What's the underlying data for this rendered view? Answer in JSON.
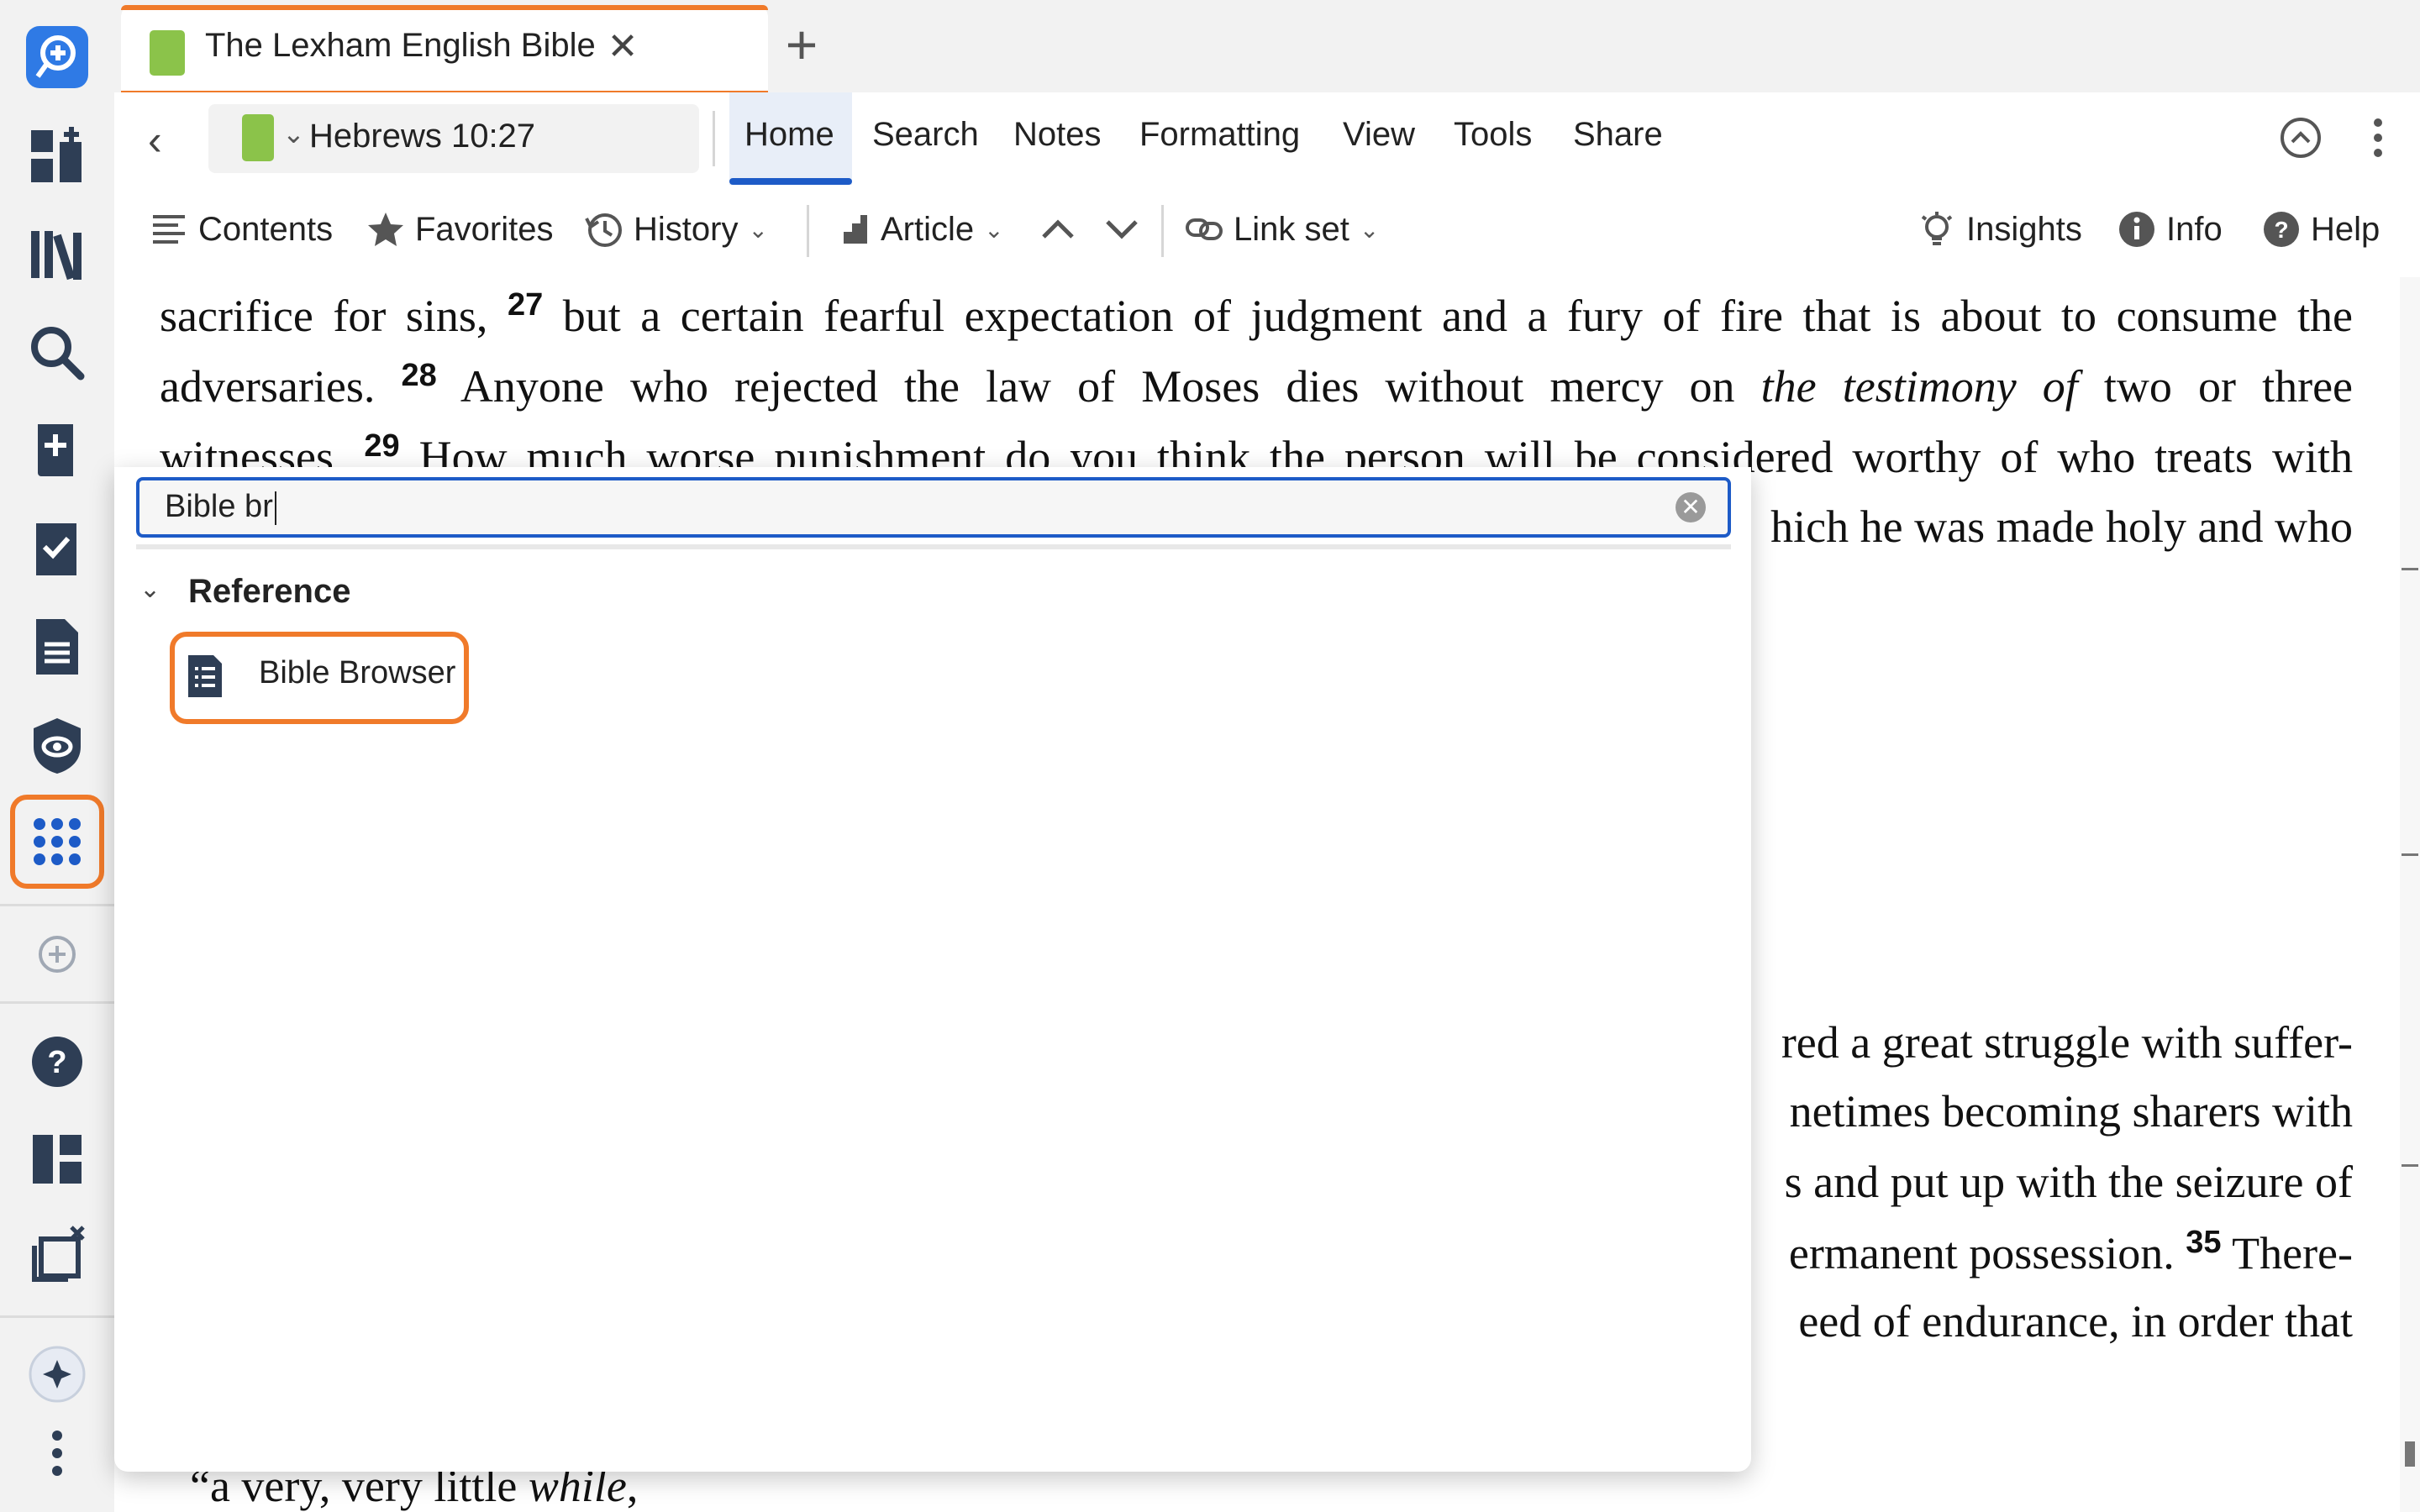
{
  "tab": {
    "title": "The Lexham English Bible",
    "close_glyph": "✕",
    "add_glyph": "+"
  },
  "ribbon": {
    "reference": "Hebrews 10:27",
    "menu": [
      "Home",
      "Search",
      "Notes",
      "Formatting",
      "View",
      "Tools",
      "Share"
    ],
    "active_menu": "Home"
  },
  "toolbar": {
    "contents": "Contents",
    "favorites": "Favorites",
    "history": "History",
    "article": "Article",
    "link_set": "Link set",
    "insights": "Insights",
    "info": "Info",
    "help": "Help"
  },
  "reader": {
    "line1": {
      "a": "sacrifice for sins,",
      "v27": "27",
      "b": "but a certain fearful expectation of judgment and a fury of fire that is about to consume the"
    },
    "line2": {
      "a": "adversaries.",
      "v28": "28",
      "b": "Anyone who rejected the law of Moses dies without mercy on",
      "italic": "the testimony of",
      "c": "two or three"
    },
    "line3": {
      "a": "witnesses.",
      "v29": "29",
      "b": "How much worse punishment do you think the person will be considered worthy of who treats with"
    },
    "line4": "hich he was made holy and who",
    "line5": "red a great struggle with suffer-",
    "line6": "netimes becoming sharers with",
    "line7": "s and put up with the seizure of",
    "line8": {
      "a": "ermanent possession.",
      "v35": "35",
      "b": "There-"
    },
    "line9": "eed of endurance, in order that",
    "line10": {
      "a": "“a very, very little",
      "italic": "while",
      "b": ","
    }
  },
  "popup": {
    "search_value": "Bible br",
    "group_label": "Reference",
    "result_label": "Bible Browser"
  },
  "colors": {
    "accent": "#1d5bc7",
    "highlight": "#f07a2a",
    "icon": "#2e3e55",
    "book": "#8bc34a"
  }
}
